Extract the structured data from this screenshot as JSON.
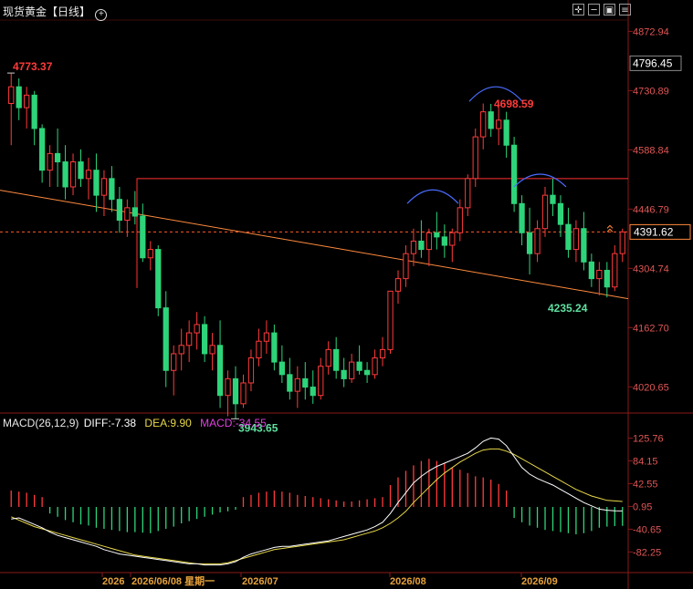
{
  "header": {
    "title": "现货黄金【日线】",
    "add_icon": "plus-circle-icon",
    "toolbar": [
      {
        "name": "crosshair-icon",
        "glyph": "✛"
      },
      {
        "name": "zoom-out-icon",
        "glyph": "─"
      },
      {
        "name": "picture-icon",
        "glyph": "▣"
      },
      {
        "name": "chart-menu-icon",
        "glyph": "≡"
      }
    ]
  },
  "macd_header": {
    "label": "MACD(26,12,9)",
    "diff": "DIFF:-7.38",
    "dea": "DEA:9.90",
    "macd": "MACD:-34.55"
  },
  "colors": {
    "up": "#ff3b3b",
    "down": "#2ed47a",
    "diff": "#ffffff",
    "dea": "#e8d84a",
    "trend": "#ff8a3d",
    "resistance": "#ff3030",
    "arcs": "#4a6cff"
  },
  "chart_data": [
    {
      "type": "candlestick",
      "title": "现货黄金【日线】",
      "ylim": [
        3960,
        4900
      ],
      "y_ticks": [
        4872.94,
        4730.89,
        4588.84,
        4446.79,
        4304.74,
        4162.7,
        4020.65
      ],
      "x_ticks": [
        "2026",
        "2026/06/08 星期一",
        "2026/07",
        "2026/08",
        "2026/09"
      ],
      "current_price": "4391.62",
      "hover_price": "4796.45",
      "annotations": {
        "high": "4773.37",
        "peak": "4698.59",
        "low": "3943.65",
        "recent_low": "4235.24"
      },
      "ohlc": [
        [
          4700,
          4773,
          4600,
          4740
        ],
        [
          4740,
          4760,
          4660,
          4690
        ],
        [
          4690,
          4740,
          4640,
          4720
        ],
        [
          4720,
          4730,
          4600,
          4640
        ],
        [
          4640,
          4650,
          4510,
          4540
        ],
        [
          4540,
          4600,
          4500,
          4580
        ],
        [
          4580,
          4640,
          4500,
          4560
        ],
        [
          4560,
          4600,
          4470,
          4500
        ],
        [
          4500,
          4580,
          4480,
          4560
        ],
        [
          4560,
          4590,
          4500,
          4520
        ],
        [
          4520,
          4570,
          4470,
          4540
        ],
        [
          4540,
          4580,
          4440,
          4480
        ],
        [
          4480,
          4540,
          4430,
          4520
        ],
        [
          4520,
          4550,
          4440,
          4470
        ],
        [
          4470,
          4500,
          4390,
          4420
        ],
        [
          4420,
          4470,
          4380,
          4450
        ],
        [
          4450,
          4490,
          4410,
          4430
        ],
        [
          4430,
          4460,
          4320,
          4330
        ],
        [
          4330,
          4370,
          4300,
          4350
        ],
        [
          4350,
          4360,
          4190,
          4210
        ],
        [
          4210,
          4250,
          4020,
          4060
        ],
        [
          4060,
          4120,
          4000,
          4100
        ],
        [
          4100,
          4160,
          4060,
          4120
        ],
        [
          4120,
          4180,
          4080,
          4150
        ],
        [
          4150,
          4200,
          4110,
          4170
        ],
        [
          4170,
          4190,
          4080,
          4100
        ],
        [
          4100,
          4150,
          4060,
          4120
        ],
        [
          4120,
          4180,
          3970,
          4000
        ],
        [
          4000,
          4060,
          3950,
          4040
        ],
        [
          4040,
          4070,
          3944,
          3980
        ],
        [
          3980,
          4050,
          3970,
          4030
        ],
        [
          4030,
          4110,
          4010,
          4090
        ],
        [
          4090,
          4160,
          4070,
          4130
        ],
        [
          4130,
          4180,
          4100,
          4150
        ],
        [
          4150,
          4170,
          4060,
          4080
        ],
        [
          4080,
          4120,
          4030,
          4050
        ],
        [
          4050,
          4090,
          3990,
          4010
        ],
        [
          4010,
          4070,
          3970,
          4040
        ],
        [
          4040,
          4080,
          3990,
          4020
        ],
        [
          4020,
          4060,
          3980,
          4000
        ],
        [
          4000,
          4090,
          3990,
          4070
        ],
        [
          4070,
          4130,
          4050,
          4110
        ],
        [
          4110,
          4140,
          4040,
          4060
        ],
        [
          4060,
          4090,
          4020,
          4040
        ],
        [
          4040,
          4100,
          4030,
          4080
        ],
        [
          4080,
          4120,
          4050,
          4060
        ],
        [
          4060,
          4080,
          4030,
          4050
        ],
        [
          4050,
          4110,
          4040,
          4090
        ],
        [
          4090,
          4140,
          4070,
          4110
        ],
        [
          4110,
          4170,
          4100,
          4250
        ],
        [
          4250,
          4300,
          4220,
          4280
        ],
        [
          4280,
          4360,
          4260,
          4340
        ],
        [
          4340,
          4400,
          4310,
          4370
        ],
        [
          4370,
          4420,
          4330,
          4350
        ],
        [
          4350,
          4400,
          4310,
          4390
        ],
        [
          4390,
          4440,
          4350,
          4380
        ],
        [
          4380,
          4410,
          4330,
          4360
        ],
        [
          4360,
          4400,
          4320,
          4390
        ],
        [
          4390,
          4470,
          4370,
          4450
        ],
        [
          4450,
          4530,
          4430,
          4520
        ],
        [
          4520,
          4640,
          4500,
          4620
        ],
        [
          4620,
          4700,
          4590,
          4680
        ],
        [
          4680,
          4699,
          4620,
          4640
        ],
        [
          4640,
          4690,
          4600,
          4660
        ],
        [
          4660,
          4680,
          4570,
          4600
        ],
        [
          4600,
          4620,
          4440,
          4460
        ],
        [
          4460,
          4480,
          4360,
          4390
        ],
        [
          4390,
          4450,
          4290,
          4340
        ],
        [
          4340,
          4420,
          4320,
          4400
        ],
        [
          4400,
          4500,
          4380,
          4480
        ],
        [
          4480,
          4520,
          4430,
          4460
        ],
        [
          4460,
          4480,
          4380,
          4410
        ],
        [
          4410,
          4450,
          4330,
          4350
        ],
        [
          4350,
          4420,
          4320,
          4400
        ],
        [
          4400,
          4440,
          4300,
          4320
        ],
        [
          4320,
          4340,
          4260,
          4280
        ],
        [
          4280,
          4320,
          4240,
          4300
        ],
        [
          4300,
          4320,
          4235,
          4260
        ],
        [
          4260,
          4360,
          4250,
          4340
        ],
        [
          4340,
          4400,
          4320,
          4392
        ]
      ],
      "resistance": 4520,
      "dashed_price": 4392
    },
    {
      "type": "bar",
      "title": "MACD(26,12,9)",
      "ylim": [
        -110,
        140
      ],
      "y_ticks": [
        125.76,
        84.15,
        42.55,
        0.95,
        -40.65,
        -82.25
      ],
      "macd_hist": [
        30,
        28,
        26,
        22,
        18,
        -12,
        -18,
        -24,
        -28,
        -32,
        -34,
        -38,
        -40,
        -42,
        -44,
        -46,
        -46,
        -47,
        -48,
        -44,
        -40,
        -36,
        -30,
        -26,
        -22,
        -18,
        -14,
        -10,
        -8,
        -5,
        18,
        22,
        26,
        28,
        30,
        28,
        26,
        22,
        20,
        18,
        16,
        14,
        12,
        10,
        10,
        12,
        14,
        16,
        18,
        40,
        54,
        66,
        76,
        84,
        88,
        84,
        80,
        72,
        68,
        62,
        56,
        54,
        50,
        42,
        30,
        -20,
        -28,
        -34,
        -38,
        -42,
        -44,
        -46,
        -48,
        -50,
        -48,
        -44,
        -38,
        -36,
        -35,
        -34.55
      ],
      "diff": [
        -22,
        -20,
        -26,
        -32,
        -38,
        -46,
        -52,
        -56,
        -60,
        -64,
        -68,
        -72,
        -78,
        -82,
        -86,
        -88,
        -90,
        -92,
        -94,
        -96,
        -98,
        -100,
        -102,
        -104,
        -104,
        -106,
        -106,
        -106,
        -104,
        -100,
        -92,
        -86,
        -82,
        -78,
        -74,
        -72,
        -72,
        -70,
        -68,
        -66,
        -64,
        -62,
        -58,
        -54,
        -50,
        -46,
        -42,
        -36,
        -28,
        -12,
        8,
        26,
        44,
        56,
        66,
        74,
        80,
        86,
        92,
        98,
        108,
        120,
        126,
        124,
        112,
        92,
        72,
        60,
        52,
        46,
        40,
        32,
        24,
        16,
        8,
        2,
        -4,
        -6,
        -7,
        -7.38
      ],
      "dea": [
        -18,
        -24,
        -30,
        -36,
        -40,
        -44,
        -48,
        -52,
        -56,
        -60,
        -64,
        -68,
        -72,
        -76,
        -80,
        -84,
        -88,
        -90,
        -92,
        -94,
        -96,
        -98,
        -100,
        -102,
        -104,
        -104,
        -104,
        -104,
        -102,
        -98,
        -94,
        -90,
        -86,
        -82,
        -78,
        -76,
        -74,
        -72,
        -70,
        -68,
        -66,
        -64,
        -62,
        -60,
        -56,
        -52,
        -48,
        -44,
        -38,
        -30,
        -20,
        -8,
        8,
        22,
        36,
        50,
        62,
        72,
        82,
        90,
        98,
        104,
        106,
        106,
        102,
        96,
        88,
        80,
        72,
        64,
        56,
        48,
        40,
        32,
        26,
        20,
        16,
        12,
        11,
        9.9
      ]
    }
  ]
}
